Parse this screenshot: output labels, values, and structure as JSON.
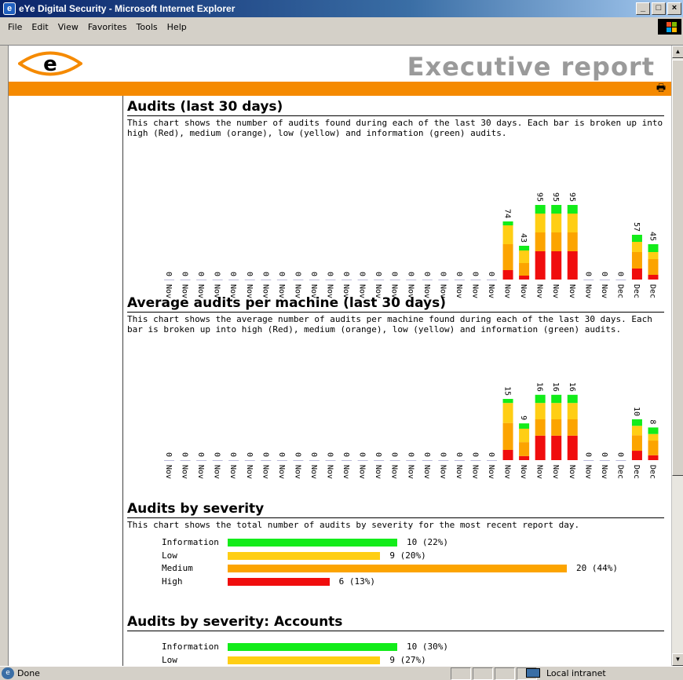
{
  "window": {
    "title": "eYe Digital Security - Microsoft Internet Explorer",
    "minimize": "_",
    "maximize": "□",
    "close": "×"
  },
  "menu": [
    "File",
    "Edit",
    "View",
    "Favorites",
    "Tools",
    "Help"
  ],
  "report": {
    "title": "Executive report",
    "logo_letter": "e"
  },
  "colors": {
    "high": "#f00d0d",
    "medium": "#fca400",
    "low": "#ffce14",
    "information": "#13ec1a",
    "accent": "#f58a00"
  },
  "days": [
    "Nov 03",
    "Nov 04",
    "Nov 05",
    "Nov 06",
    "Nov 07",
    "Nov 08",
    "Nov 09",
    "Nov 10",
    "Nov 11",
    "Nov 12",
    "Nov 13",
    "Nov 14",
    "Nov 15",
    "Nov 16",
    "Nov 17",
    "Nov 18",
    "Nov 19",
    "Nov 20",
    "Nov 21",
    "Nov 22",
    "Nov 23",
    "Nov 24",
    "Nov 25",
    "Nov 26",
    "Nov 27",
    "Nov 28",
    "Nov 29",
    "Nov 30",
    "Dec 01",
    "Dec 02",
    "Dec 03"
  ],
  "sections": {
    "audits": {
      "title": "Audits (last 30 days)",
      "desc": "This chart shows the number of audits found during each of the last 30 days. Each bar is broken up into high (Red), medium (orange), low (yellow) and information (green) audits."
    },
    "avg": {
      "title": "Average audits per machine (last 30 days)",
      "desc": "This chart shows the average number of audits per machine found during each of the last 30 days. Each bar is broken up into high (Red), medium (orange), low (yellow) and information (green) audits."
    },
    "severity": {
      "title": "Audits by severity",
      "desc": "This chart shows the total number of audits by severity for the most recent report day."
    },
    "accounts": {
      "title": "Audits by severity: Accounts"
    }
  },
  "chart_data": [
    {
      "type": "bar",
      "title": "Audits (last 30 days)",
      "categories": [
        "Nov 03",
        "Nov 04",
        "Nov 05",
        "Nov 06",
        "Nov 07",
        "Nov 08",
        "Nov 09",
        "Nov 10",
        "Nov 11",
        "Nov 12",
        "Nov 13",
        "Nov 14",
        "Nov 15",
        "Nov 16",
        "Nov 17",
        "Nov 18",
        "Nov 19",
        "Nov 20",
        "Nov 21",
        "Nov 22",
        "Nov 23",
        "Nov 24",
        "Nov 25",
        "Nov 26",
        "Nov 27",
        "Nov 28",
        "Nov 29",
        "Nov 30",
        "Dec 01",
        "Dec 02",
        "Dec 03"
      ],
      "totals": [
        0,
        0,
        0,
        0,
        0,
        0,
        0,
        0,
        0,
        0,
        0,
        0,
        0,
        0,
        0,
        0,
        0,
        0,
        0,
        0,
        0,
        74,
        43,
        95,
        95,
        95,
        0,
        0,
        0,
        57,
        45
      ],
      "stacked": true,
      "series": [
        {
          "name": "high",
          "values": [
            0,
            0,
            0,
            0,
            0,
            0,
            0,
            0,
            0,
            0,
            0,
            0,
            0,
            0,
            0,
            0,
            0,
            0,
            0,
            0,
            0,
            12,
            5,
            36,
            36,
            36,
            0,
            0,
            0,
            14,
            6
          ]
        },
        {
          "name": "medium",
          "values": [
            0,
            0,
            0,
            0,
            0,
            0,
            0,
            0,
            0,
            0,
            0,
            0,
            0,
            0,
            0,
            0,
            0,
            0,
            0,
            0,
            0,
            33,
            16,
            24,
            24,
            24,
            0,
            0,
            0,
            21,
            20
          ]
        },
        {
          "name": "low",
          "values": [
            0,
            0,
            0,
            0,
            0,
            0,
            0,
            0,
            0,
            0,
            0,
            0,
            0,
            0,
            0,
            0,
            0,
            0,
            0,
            0,
            0,
            24,
            16,
            24,
            24,
            24,
            0,
            0,
            0,
            13,
            9
          ]
        },
        {
          "name": "information",
          "values": [
            0,
            0,
            0,
            0,
            0,
            0,
            0,
            0,
            0,
            0,
            0,
            0,
            0,
            0,
            0,
            0,
            0,
            0,
            0,
            0,
            0,
            5,
            6,
            11,
            11,
            11,
            0,
            0,
            0,
            9,
            10
          ]
        }
      ]
    },
    {
      "type": "bar",
      "title": "Average audits per machine (last 30 days)",
      "categories": [
        "Nov 03",
        "Nov 04",
        "Nov 05",
        "Nov 06",
        "Nov 07",
        "Nov 08",
        "Nov 09",
        "Nov 10",
        "Nov 11",
        "Nov 12",
        "Nov 13",
        "Nov 14",
        "Nov 15",
        "Nov 16",
        "Nov 17",
        "Nov 18",
        "Nov 19",
        "Nov 20",
        "Nov 21",
        "Nov 22",
        "Nov 23",
        "Nov 24",
        "Nov 25",
        "Nov 26",
        "Nov 27",
        "Nov 28",
        "Nov 29",
        "Nov 30",
        "Dec 01",
        "Dec 02",
        "Dec 03"
      ],
      "totals": [
        0,
        0,
        0,
        0,
        0,
        0,
        0,
        0,
        0,
        0,
        0,
        0,
        0,
        0,
        0,
        0,
        0,
        0,
        0,
        0,
        0,
        15,
        9,
        16,
        16,
        16,
        0,
        0,
        0,
        10,
        8
      ],
      "stacked": true,
      "series": [
        {
          "name": "high",
          "values": [
            0,
            0,
            0,
            0,
            0,
            0,
            0,
            0,
            0,
            0,
            0,
            0,
            0,
            0,
            0,
            0,
            0,
            0,
            0,
            0,
            0,
            2.5,
            1,
            6,
            6,
            6,
            0,
            0,
            0,
            2.3,
            1.2
          ]
        },
        {
          "name": "medium",
          "values": [
            0,
            0,
            0,
            0,
            0,
            0,
            0,
            0,
            0,
            0,
            0,
            0,
            0,
            0,
            0,
            0,
            0,
            0,
            0,
            0,
            0,
            6.6,
            3.4,
            4,
            4,
            4,
            0,
            0,
            0,
            3.8,
            3.6
          ]
        },
        {
          "name": "low",
          "values": [
            0,
            0,
            0,
            0,
            0,
            0,
            0,
            0,
            0,
            0,
            0,
            0,
            0,
            0,
            0,
            0,
            0,
            0,
            0,
            0,
            0,
            4.9,
            3.3,
            4,
            4,
            4,
            0,
            0,
            0,
            2.3,
            1.6
          ]
        },
        {
          "name": "information",
          "values": [
            0,
            0,
            0,
            0,
            0,
            0,
            0,
            0,
            0,
            0,
            0,
            0,
            0,
            0,
            0,
            0,
            0,
            0,
            0,
            0,
            0,
            1,
            1.3,
            2,
            2,
            2,
            0,
            0,
            0,
            1.6,
            1.6
          ]
        }
      ]
    },
    {
      "type": "bar",
      "orientation": "horizontal",
      "title": "Audits by severity",
      "categories": [
        "Information",
        "Low",
        "Medium",
        "High"
      ],
      "values": [
        10,
        9,
        20,
        6
      ],
      "value_labels": [
        "10 (22%)",
        "9 (20%)",
        "20 (44%)",
        "6 (13%)"
      ],
      "colors": [
        "#13ec1a",
        "#ffce14",
        "#fca400",
        "#f00d0d"
      ]
    },
    {
      "type": "bar",
      "orientation": "horizontal",
      "title": "Audits by severity: Accounts",
      "categories": [
        "Information",
        "Low"
      ],
      "values": [
        10,
        9
      ],
      "value_labels": [
        "10 (30%)",
        "9 (27%)"
      ],
      "colors": [
        "#13ec1a",
        "#ffce14"
      ]
    }
  ],
  "status": {
    "text": "Done",
    "zone": "Local intranet"
  }
}
